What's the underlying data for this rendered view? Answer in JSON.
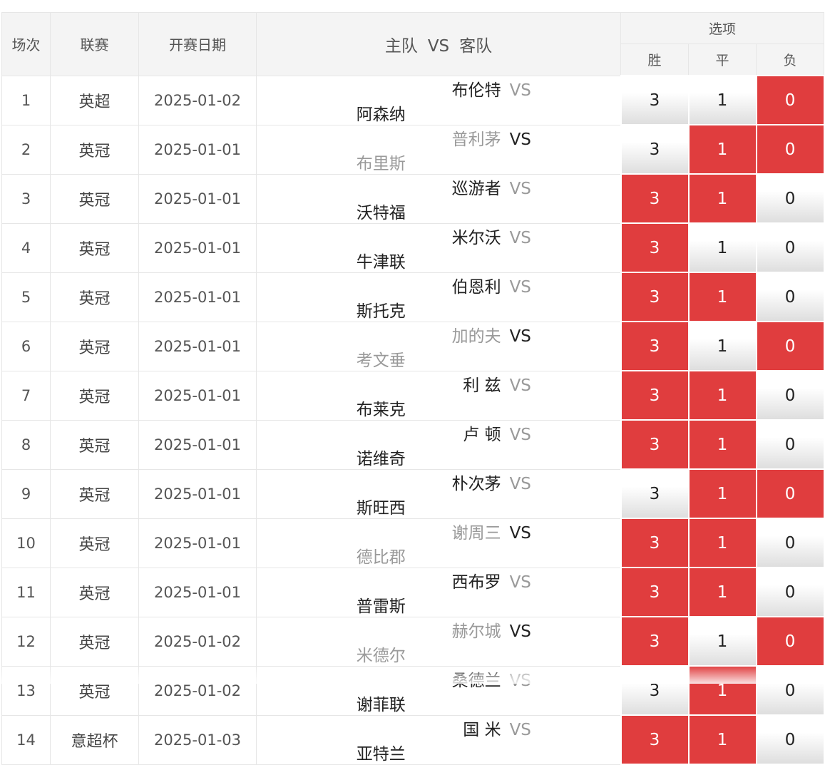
{
  "header": {
    "round": "场次",
    "league": "联赛",
    "date": "开赛日期",
    "home": "主队",
    "vs": "VS",
    "away": "客队",
    "options": "选项",
    "win": "胜",
    "draw": "平",
    "lose": "负"
  },
  "rows": [
    {
      "no": "1",
      "league": "英超",
      "date": "2025-01-02",
      "home": "布伦特",
      "vs": "VS",
      "away": "阿森纳",
      "teams_muted": false,
      "win": "3",
      "draw": "1",
      "lose": "0",
      "sel": [
        false,
        false,
        true
      ]
    },
    {
      "no": "2",
      "league": "英冠",
      "date": "2025-01-01",
      "home": "普利茅",
      "vs": "VS",
      "away": "布里斯",
      "teams_muted": true,
      "win": "3",
      "draw": "1",
      "lose": "0",
      "sel": [
        false,
        true,
        true
      ]
    },
    {
      "no": "3",
      "league": "英冠",
      "date": "2025-01-01",
      "home": "巡游者",
      "vs": "VS",
      "away": "沃特福",
      "teams_muted": false,
      "win": "3",
      "draw": "1",
      "lose": "0",
      "sel": [
        true,
        true,
        false
      ]
    },
    {
      "no": "4",
      "league": "英冠",
      "date": "2025-01-01",
      "home": "米尔沃",
      "vs": "VS",
      "away": "牛津联",
      "teams_muted": false,
      "win": "3",
      "draw": "1",
      "lose": "0",
      "sel": [
        true,
        false,
        false
      ]
    },
    {
      "no": "5",
      "league": "英冠",
      "date": "2025-01-01",
      "home": "伯恩利",
      "vs": "VS",
      "away": "斯托克",
      "teams_muted": false,
      "win": "3",
      "draw": "1",
      "lose": "0",
      "sel": [
        true,
        true,
        false
      ]
    },
    {
      "no": "6",
      "league": "英冠",
      "date": "2025-01-01",
      "home": "加的夫",
      "vs": "VS",
      "away": "考文垂",
      "teams_muted": true,
      "win": "3",
      "draw": "1",
      "lose": "0",
      "sel": [
        true,
        false,
        true
      ]
    },
    {
      "no": "7",
      "league": "英冠",
      "date": "2025-01-01",
      "home": "利 兹",
      "vs": "VS",
      "away": "布莱克",
      "teams_muted": false,
      "win": "3",
      "draw": "1",
      "lose": "0",
      "sel": [
        true,
        true,
        false
      ]
    },
    {
      "no": "8",
      "league": "英冠",
      "date": "2025-01-01",
      "home": "卢 顿",
      "vs": "VS",
      "away": "诺维奇",
      "teams_muted": false,
      "win": "3",
      "draw": "1",
      "lose": "0",
      "sel": [
        true,
        true,
        false
      ]
    },
    {
      "no": "9",
      "league": "英冠",
      "date": "2025-01-01",
      "home": "朴次茅",
      "vs": "VS",
      "away": "斯旺西",
      "teams_muted": false,
      "win": "3",
      "draw": "1",
      "lose": "0",
      "sel": [
        false,
        true,
        true
      ]
    },
    {
      "no": "10",
      "league": "英冠",
      "date": "2025-01-01",
      "home": "谢周三",
      "vs": "VS",
      "away": "德比郡",
      "teams_muted": true,
      "win": "3",
      "draw": "1",
      "lose": "0",
      "sel": [
        true,
        true,
        false
      ]
    },
    {
      "no": "11",
      "league": "英冠",
      "date": "2025-01-01",
      "home": "西布罗",
      "vs": "VS",
      "away": "普雷斯",
      "teams_muted": false,
      "win": "3",
      "draw": "1",
      "lose": "0",
      "sel": [
        true,
        true,
        false
      ]
    },
    {
      "no": "12",
      "league": "英冠",
      "date": "2025-01-02",
      "home": "赫尔城",
      "vs": "VS",
      "away": "米德尔",
      "teams_muted": true,
      "win": "3",
      "draw": "1",
      "lose": "0",
      "sel": [
        true,
        false,
        true
      ]
    },
    {
      "no": "13",
      "league": "英冠",
      "date": "2025-01-02",
      "home": "桑德兰",
      "vs": "VS",
      "away": "谢菲联",
      "teams_muted": false,
      "win": "3",
      "draw": "1",
      "lose": "0",
      "sel": [
        false,
        true,
        false
      ]
    },
    {
      "no": "14",
      "league": "意超杯",
      "date": "2025-01-03",
      "home": "国 米",
      "vs": "VS",
      "away": "亚特兰",
      "teams_muted": false,
      "win": "3",
      "draw": "1",
      "lose": "0",
      "sel": [
        true,
        true,
        false
      ]
    }
  ],
  "colors": {
    "selected": "#e03d3e",
    "header_bg": "#f4f4f4",
    "muted_text": "#9a9a9a"
  }
}
